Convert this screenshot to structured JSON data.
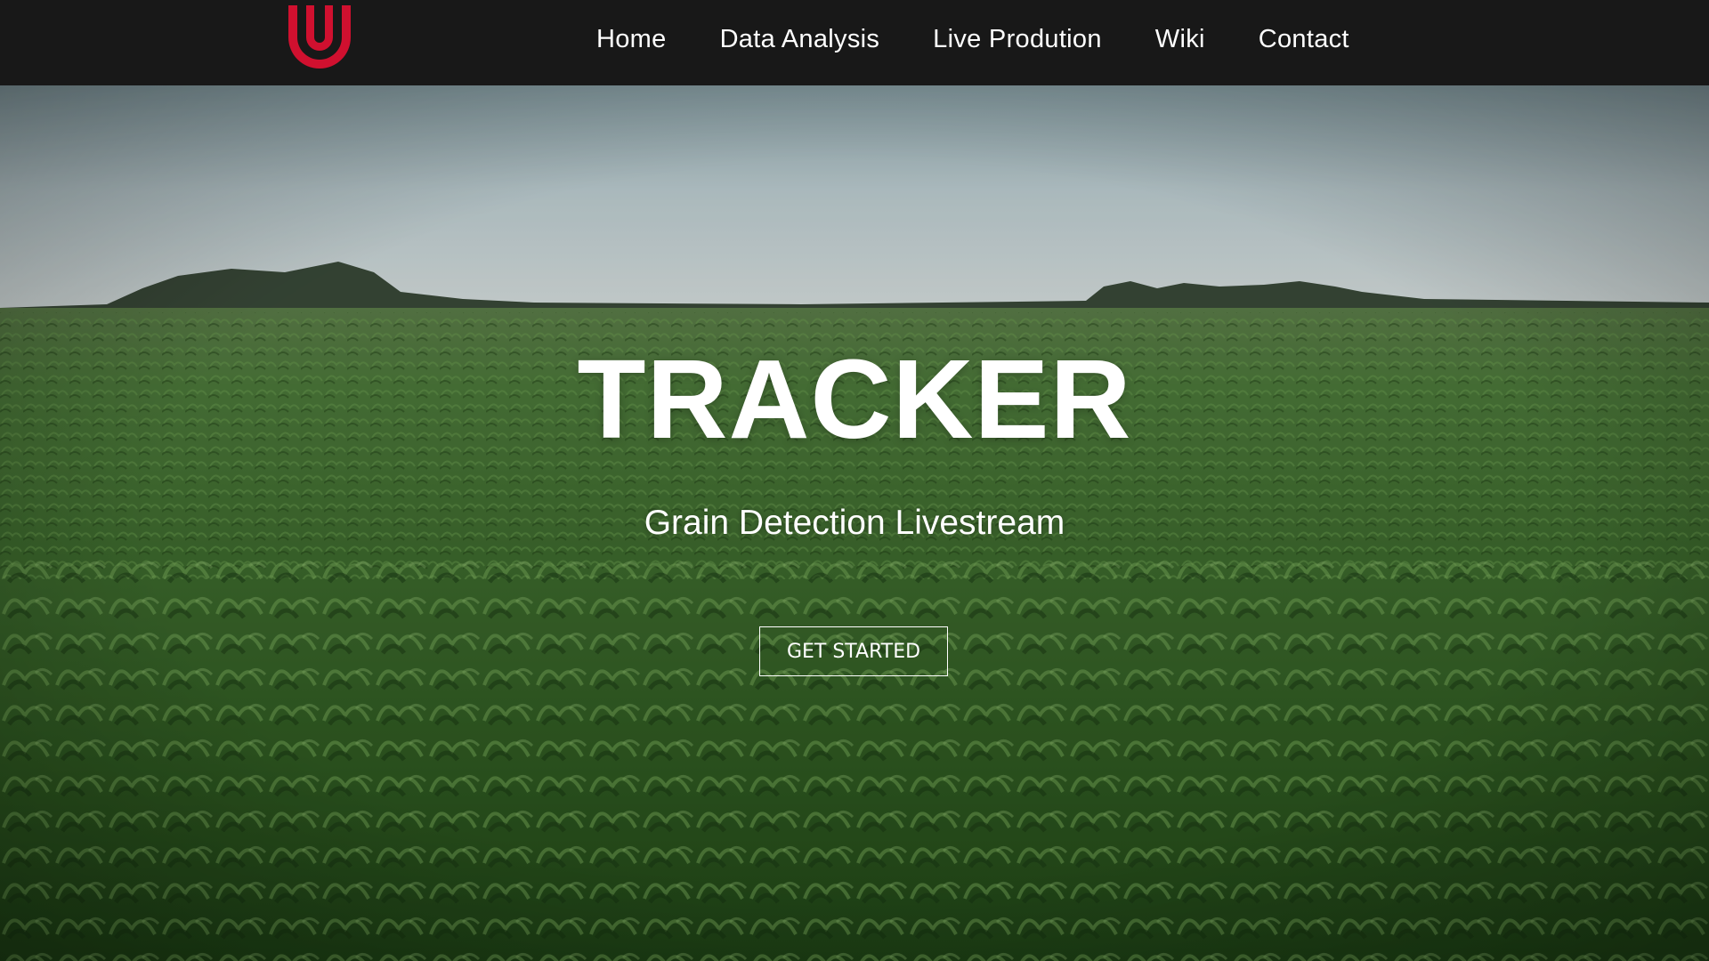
{
  "nav": {
    "logo_icon": "u-logo-icon",
    "logo_color": "#d0102f",
    "items": [
      {
        "label": "Home"
      },
      {
        "label": "Data Analysis"
      },
      {
        "label": "Live Prodution"
      },
      {
        "label": "Wiki"
      },
      {
        "label": "Contact"
      }
    ],
    "background": "#181818"
  },
  "hero": {
    "title": "TRACKER",
    "subtitle": "Grain Detection Livestream",
    "cta_label": "GET STARTED",
    "background_image": "corn-field-photo"
  }
}
